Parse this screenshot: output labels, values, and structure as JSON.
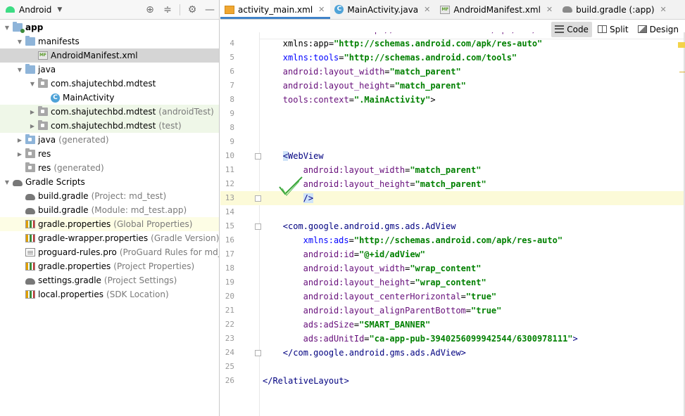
{
  "project_panel": {
    "view_mode": "Android",
    "toolbar_icons": [
      "locate-icon",
      "collapse-icon",
      "gear-icon",
      "minimize-icon"
    ],
    "tree": [
      {
        "label": "app",
        "hint": "",
        "level": 0,
        "expanded": true,
        "icon": "module-folder",
        "bold": true
      },
      {
        "label": "manifests",
        "hint": "",
        "level": 1,
        "expanded": true,
        "icon": "folder"
      },
      {
        "label": "AndroidManifest.xml",
        "hint": "",
        "level": 2,
        "expanded": null,
        "icon": "manifest-file",
        "selected": true
      },
      {
        "label": "java",
        "hint": "",
        "level": 1,
        "expanded": true,
        "icon": "folder"
      },
      {
        "label": "com.shajutechbd.mdtest",
        "hint": "",
        "level": 2,
        "expanded": true,
        "icon": "package"
      },
      {
        "label": "MainActivity",
        "hint": "",
        "level": 3,
        "expanded": null,
        "icon": "class"
      },
      {
        "label": "com.shajutechbd.mdtest",
        "hint": "(androidTest)",
        "level": 2,
        "expanded": false,
        "icon": "package",
        "test": true
      },
      {
        "label": "com.shajutechbd.mdtest",
        "hint": "(test)",
        "level": 2,
        "expanded": false,
        "icon": "package",
        "test": true
      },
      {
        "label": "java",
        "hint": "(generated)",
        "level": 1,
        "expanded": false,
        "icon": "folder-generated"
      },
      {
        "label": "res",
        "hint": "",
        "level": 1,
        "expanded": false,
        "icon": "folder-res"
      },
      {
        "label": "res",
        "hint": "(generated)",
        "level": 1,
        "expanded": null,
        "icon": "folder-res"
      },
      {
        "label": "Gradle Scripts",
        "hint": "",
        "level": 0,
        "expanded": true,
        "icon": "gradle"
      },
      {
        "label": "build.gradle",
        "hint": "(Project: md_test)",
        "level": 1,
        "expanded": null,
        "icon": "gradle"
      },
      {
        "label": "build.gradle",
        "hint": "(Module: md_test.app)",
        "level": 1,
        "expanded": null,
        "icon": "gradle"
      },
      {
        "label": "gradle.properties",
        "hint": "(Global Properties)",
        "level": 1,
        "expanded": null,
        "icon": "properties",
        "yellow": true
      },
      {
        "label": "gradle-wrapper.properties",
        "hint": "(Gradle Version)",
        "level": 1,
        "expanded": null,
        "icon": "properties"
      },
      {
        "label": "proguard-rules.pro",
        "hint": "(ProGuard Rules for md_test.a",
        "level": 1,
        "expanded": null,
        "icon": "text-file"
      },
      {
        "label": "gradle.properties",
        "hint": "(Project Properties)",
        "level": 1,
        "expanded": null,
        "icon": "properties"
      },
      {
        "label": "settings.gradle",
        "hint": "(Project Settings)",
        "level": 1,
        "expanded": null,
        "icon": "gradle"
      },
      {
        "label": "local.properties",
        "hint": "(SDK Location)",
        "level": 1,
        "expanded": null,
        "icon": "properties"
      }
    ]
  },
  "editor": {
    "tabs": [
      {
        "label": "activity_main.xml",
        "icon": "layout-file",
        "active": true
      },
      {
        "label": "MainActivity.java",
        "icon": "class",
        "active": false
      },
      {
        "label": "AndroidManifest.xml",
        "icon": "manifest-file",
        "active": false
      },
      {
        "label": "build.gradle (:app)",
        "icon": "gradle",
        "active": false
      }
    ],
    "view_modes": [
      {
        "label": "Code",
        "icon": "code-view-icon",
        "active": true
      },
      {
        "label": "Split",
        "icon": "split-view-icon",
        "active": false
      },
      {
        "label": "Design",
        "icon": "design-view-icon",
        "active": false
      }
    ],
    "current_line": 13,
    "lines": [
      {
        "n": "3",
        "indent": 4,
        "tokens": [
          {
            "t": "xmlns:android=\"http://schemas.android.com/apk/res/android\"",
            "c": "t-attr"
          }
        ],
        "clipped": true
      },
      {
        "n": "4",
        "indent": 4,
        "tokens": [
          {
            "t": "xmlns:app",
            "c": "t-plain"
          },
          {
            "t": "=",
            "c": "t-plain"
          },
          {
            "t": "\"http://schemas.android.com/apk/res-auto\"",
            "c": "t-val"
          }
        ]
      },
      {
        "n": "5",
        "indent": 4,
        "tokens": [
          {
            "t": "xmlns:",
            "c": "t-ns"
          },
          {
            "t": "tools",
            "c": "t-ns"
          },
          {
            "t": "=",
            "c": "t-plain"
          },
          {
            "t": "\"http://schemas.android.com/tools\"",
            "c": "t-val"
          }
        ]
      },
      {
        "n": "6",
        "indent": 4,
        "tokens": [
          {
            "t": "android:",
            "c": "t-attr"
          },
          {
            "t": "layout_width",
            "c": "t-attr"
          },
          {
            "t": "=",
            "c": "t-plain"
          },
          {
            "t": "\"match_parent\"",
            "c": "t-val"
          }
        ]
      },
      {
        "n": "7",
        "indent": 4,
        "tokens": [
          {
            "t": "android:",
            "c": "t-attr"
          },
          {
            "t": "layout_height",
            "c": "t-attr"
          },
          {
            "t": "=",
            "c": "t-plain"
          },
          {
            "t": "\"match_parent\"",
            "c": "t-val"
          }
        ]
      },
      {
        "n": "8",
        "indent": 4,
        "tokens": [
          {
            "t": "tools:",
            "c": "t-attr"
          },
          {
            "t": "context",
            "c": "t-attr"
          },
          {
            "t": "=",
            "c": "t-plain"
          },
          {
            "t": "\".MainActivity\"",
            "c": "t-val"
          },
          {
            "t": ">",
            "c": "t-plain"
          }
        ]
      },
      {
        "n": "9",
        "indent": 0,
        "tokens": []
      },
      {
        "n": "8",
        "indent": 0,
        "tokens": []
      },
      {
        "n": "9",
        "indent": 0,
        "tokens": []
      },
      {
        "n": "10",
        "indent": 4,
        "tokens": [
          {
            "t": "<",
            "c": "t-tag t-brace"
          },
          {
            "t": "WebView",
            "c": "t-tag"
          }
        ],
        "fold": true
      },
      {
        "n": "11",
        "indent": 8,
        "tokens": [
          {
            "t": "android:",
            "c": "t-attr"
          },
          {
            "t": "layout_width",
            "c": "t-attr"
          },
          {
            "t": "=",
            "c": "t-plain"
          },
          {
            "t": "\"match_parent\"",
            "c": "t-val"
          }
        ]
      },
      {
        "n": "12",
        "indent": 8,
        "tokens": [
          {
            "t": "android:",
            "c": "t-attr"
          },
          {
            "t": "layout_height",
            "c": "t-attr"
          },
          {
            "t": "=",
            "c": "t-plain"
          },
          {
            "t": "\"match_parent\"",
            "c": "t-val"
          }
        ]
      },
      {
        "n": "13",
        "indent": 8,
        "tokens": [
          {
            "t": "/>",
            "c": "t-tag t-brace"
          }
        ],
        "fold": true
      },
      {
        "n": "14",
        "indent": 0,
        "tokens": []
      },
      {
        "n": "15",
        "indent": 4,
        "tokens": [
          {
            "t": "<com.google.android.gms.ads.AdView",
            "c": "t-tag"
          }
        ],
        "fold": true
      },
      {
        "n": "16",
        "indent": 8,
        "tokens": [
          {
            "t": "xmlns:ads",
            "c": "t-ns"
          },
          {
            "t": "=",
            "c": "t-plain"
          },
          {
            "t": "\"http://schemas.android.com/apk/res-auto\"",
            "c": "t-val"
          }
        ]
      },
      {
        "n": "17",
        "indent": 8,
        "tokens": [
          {
            "t": "android:",
            "c": "t-attr"
          },
          {
            "t": "id",
            "c": "t-attr"
          },
          {
            "t": "=",
            "c": "t-plain"
          },
          {
            "t": "\"@+id/adView\"",
            "c": "t-val"
          }
        ]
      },
      {
        "n": "18",
        "indent": 8,
        "tokens": [
          {
            "t": "android:",
            "c": "t-attr"
          },
          {
            "t": "layout_width",
            "c": "t-attr"
          },
          {
            "t": "=",
            "c": "t-plain"
          },
          {
            "t": "\"wrap_content\"",
            "c": "t-val"
          }
        ]
      },
      {
        "n": "19",
        "indent": 8,
        "tokens": [
          {
            "t": "android:",
            "c": "t-attr"
          },
          {
            "t": "layout_height",
            "c": "t-attr"
          },
          {
            "t": "=",
            "c": "t-plain"
          },
          {
            "t": "\"wrap_content\"",
            "c": "t-val"
          }
        ]
      },
      {
        "n": "20",
        "indent": 8,
        "tokens": [
          {
            "t": "android:",
            "c": "t-attr"
          },
          {
            "t": "layout_centerHorizontal",
            "c": "t-attr"
          },
          {
            "t": "=",
            "c": "t-plain"
          },
          {
            "t": "\"true\"",
            "c": "t-val"
          }
        ]
      },
      {
        "n": "21",
        "indent": 8,
        "tokens": [
          {
            "t": "android:",
            "c": "t-attr"
          },
          {
            "t": "layout_alignParentBottom",
            "c": "t-attr"
          },
          {
            "t": "=",
            "c": "t-plain"
          },
          {
            "t": "\"true\"",
            "c": "t-val"
          }
        ]
      },
      {
        "n": "22",
        "indent": 8,
        "tokens": [
          {
            "t": "ads:",
            "c": "t-attr"
          },
          {
            "t": "adSize",
            "c": "t-attr"
          },
          {
            "t": "=",
            "c": "t-plain"
          },
          {
            "t": "\"SMART_BANNER\"",
            "c": "t-val"
          }
        ]
      },
      {
        "n": "23",
        "indent": 8,
        "tokens": [
          {
            "t": "ads:",
            "c": "t-attr"
          },
          {
            "t": "adUnitId",
            "c": "t-attr"
          },
          {
            "t": "=",
            "c": "t-plain"
          },
          {
            "t": "\"ca-app-pub-3940256099942544/6300978111\"",
            "c": "t-val"
          },
          {
            "t": ">",
            "c": "t-tag"
          }
        ]
      },
      {
        "n": "24",
        "indent": 4,
        "tokens": [
          {
            "t": "</com.google.android.gms.ads.AdView>",
            "c": "t-tag"
          }
        ],
        "fold": true
      },
      {
        "n": "25",
        "indent": 0,
        "tokens": []
      },
      {
        "n": "26",
        "indent": 0,
        "tokens": [
          {
            "t": "</RelativeLayout>",
            "c": "t-tag"
          }
        ]
      }
    ]
  },
  "colors": {
    "accent": "#4083c9",
    "selection": "#d5d5d5",
    "current_line": "#fcfad8",
    "test_bg": "#eff7e8"
  }
}
